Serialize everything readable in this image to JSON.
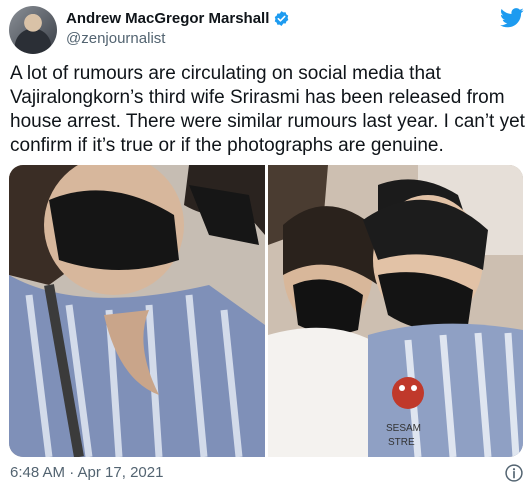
{
  "author": {
    "display_name": "Andrew MacGregor Marshall",
    "handle": "@zenjournalist",
    "verified": true
  },
  "tweet": {
    "text": "A lot of rumours are circulating on social media that Vajiralongkorn’s third wife Srirasmi has been released from house arrest. There were similar rumours last year. I can’t yet confirm if it’s true or if the photographs are genuine.",
    "timestamp": "6:48 AM · Apr 17, 2021"
  },
  "media": {
    "photos": [
      "photo-1",
      "photo-2"
    ],
    "sweatshirt_text_line1": "SESAM",
    "sweatshirt_text_line2": "STRE"
  },
  "icons": {
    "logo": "twitter-bird-icon",
    "verified": "verified-badge-icon",
    "info": "info-icon"
  },
  "colors": {
    "brand_blue": "#1d9bf0",
    "text_primary": "#0f1419",
    "text_secondary": "#536471"
  }
}
